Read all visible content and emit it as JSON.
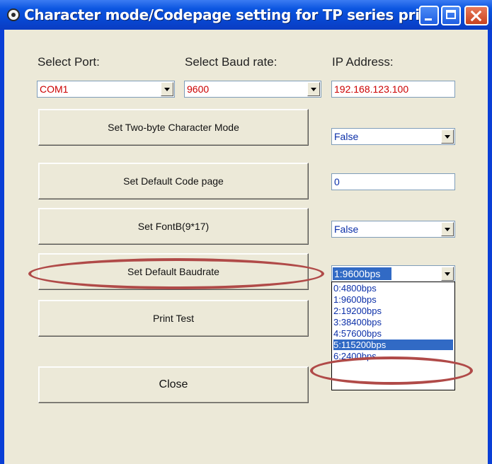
{
  "window": {
    "title": "Character mode/Codepage setting for TP series pri..."
  },
  "labels": {
    "port": "Select Port:",
    "baud": "Select Baud rate:",
    "ip": "IP Address:"
  },
  "port_combo": {
    "value": "COM1"
  },
  "baud_combo": {
    "value": "9600"
  },
  "ip_field": {
    "value": "192.168.123.100"
  },
  "buttons": {
    "two_byte": "Set Two-byte Character Mode",
    "code_page": "Set Default Code page",
    "fontb": "Set FontB(9*17)",
    "baudrate": "Set Default Baudrate",
    "print_test": "Print Test",
    "close": "Close"
  },
  "two_byte_combo": {
    "value": "False"
  },
  "code_page_field": {
    "value": "0"
  },
  "fontb_combo": {
    "value": "False"
  },
  "baudrate_combo": {
    "value": "1:9600bps",
    "options": [
      "0:4800bps",
      "1:9600bps",
      "2:19200bps",
      "3:38400bps",
      "4:57600bps",
      "5:115200bps",
      "6:2400bps"
    ],
    "highlighted": "5:115200bps"
  },
  "colors": {
    "value_red": "#cc0000",
    "value_blue": "#0b2fa8",
    "selection": "#316ac5",
    "annotation": "#b04a48"
  }
}
